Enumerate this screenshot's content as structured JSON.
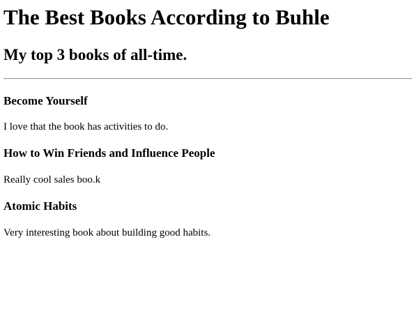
{
  "header": {
    "title": "The Best Books According to Buhle",
    "subtitle": "My top 3 books of all-time."
  },
  "books": [
    {
      "title": "Become Yourself",
      "comment": "I love that the book has activities to do."
    },
    {
      "title": "How to Win Friends and Influence People",
      "comment": "Really cool sales boo.k"
    },
    {
      "title": "Atomic Habits",
      "comment": "Very interesting book about building good habits."
    }
  ]
}
